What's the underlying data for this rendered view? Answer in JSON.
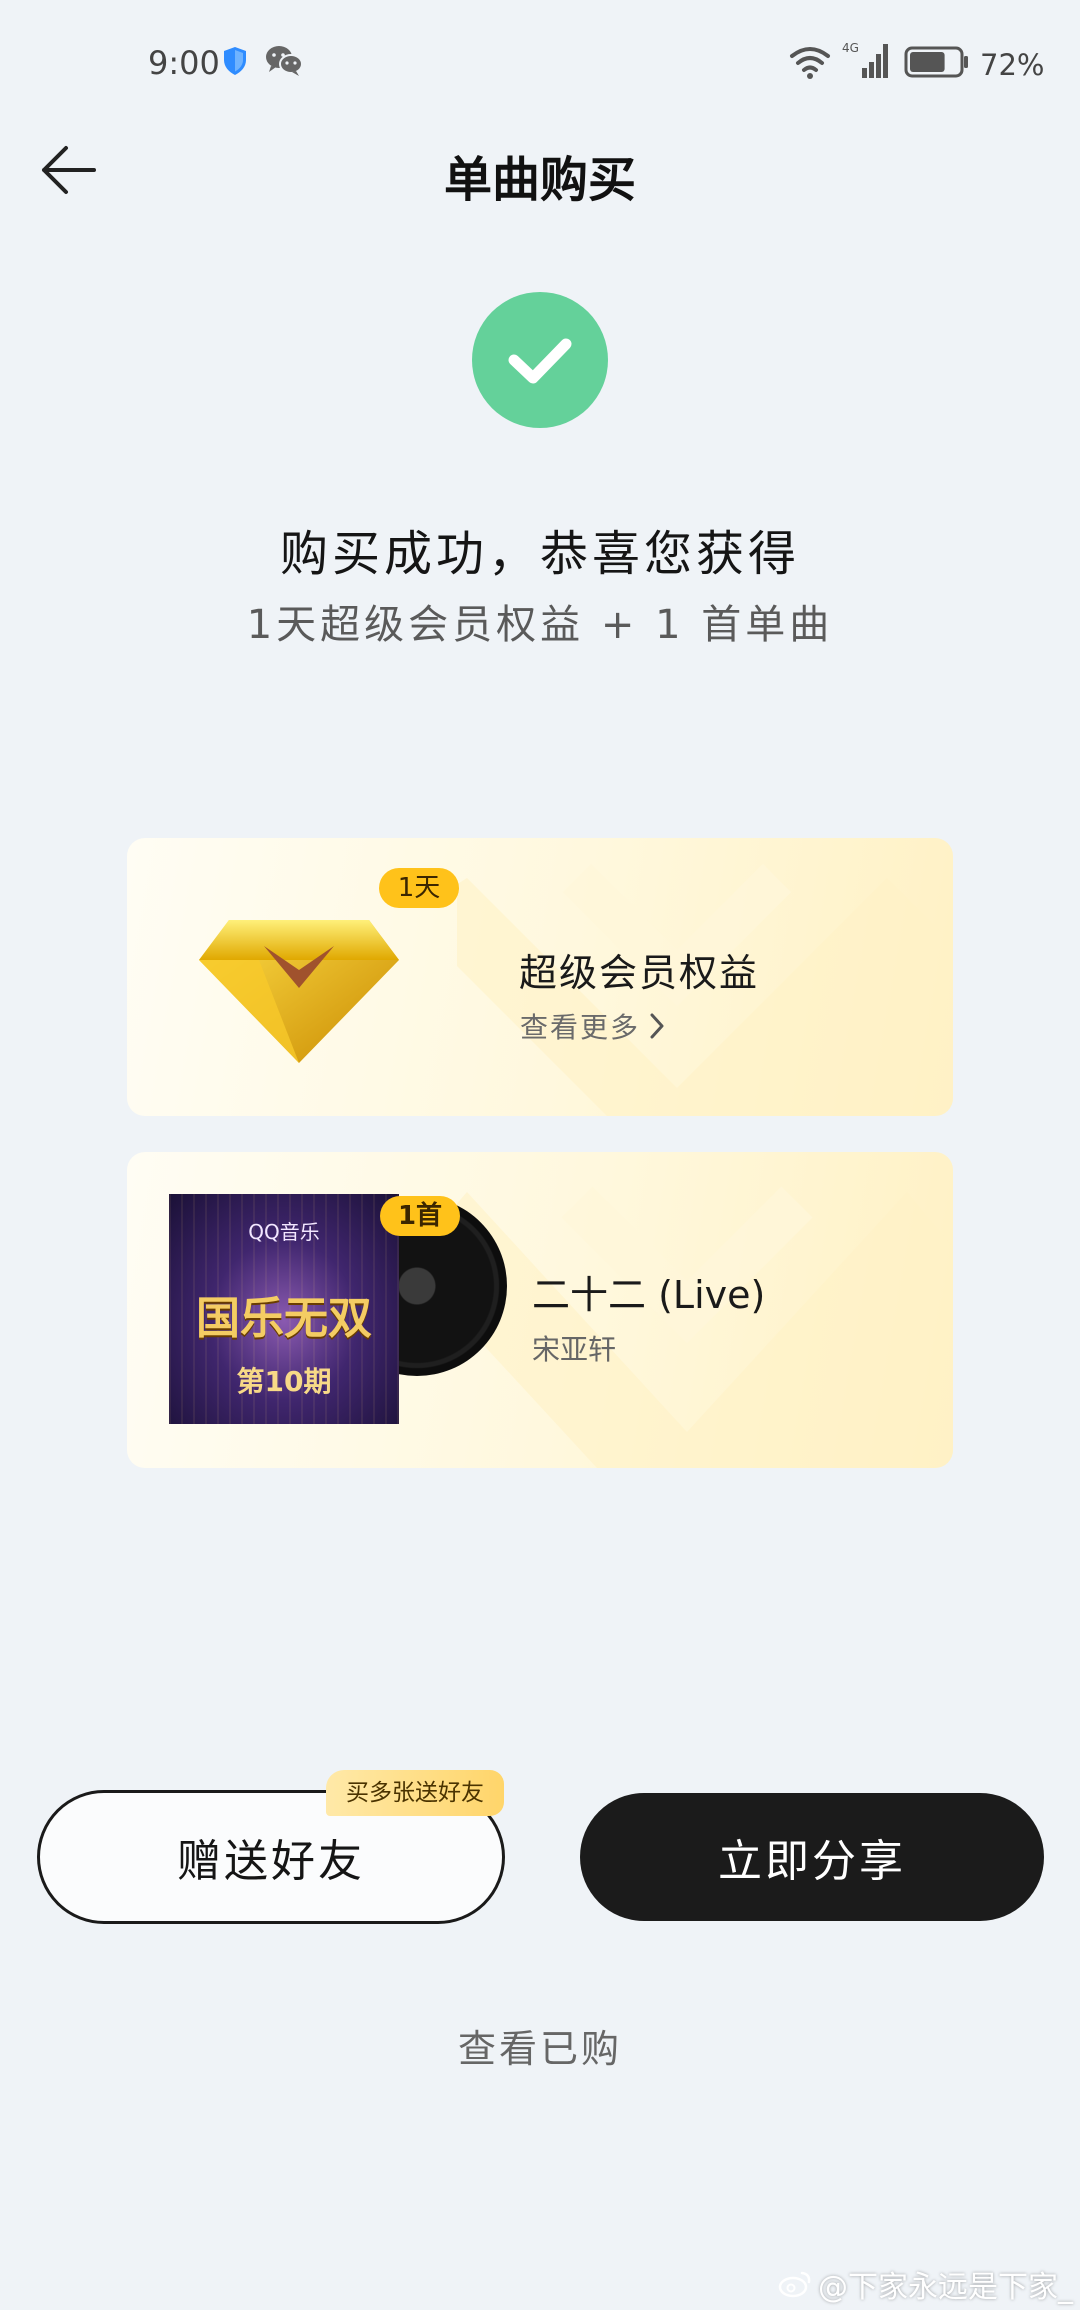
{
  "status_bar": {
    "time": "9:00",
    "network": "4G",
    "battery_percent": "72%",
    "battery_level": 0.72
  },
  "header": {
    "title": "单曲购买"
  },
  "success": {
    "title": "购买成功，恭喜您获得",
    "subtitle": "1天超级会员权益 + 1 首单曲"
  },
  "vip_card": {
    "badge": "1天",
    "name": "超级会员权益",
    "more_label": "查看更多"
  },
  "song_card": {
    "badge": "1首",
    "name": "二十二 (Live)",
    "artist": "宋亚轩",
    "cover": {
      "logo": "QQ音乐",
      "title": "国乐无双",
      "episode": "第10期"
    }
  },
  "actions": {
    "gift_label": "赠送好友",
    "gift_tag": "买多张送好友",
    "share_label": "立即分享",
    "view_bought_label": "查看已购"
  },
  "watermark": "@下家永远是下家_",
  "colors": {
    "success_green": "#64d19a",
    "badge_yellow": "#ffc21a",
    "primary_dark": "#1b1b1b",
    "page_background": "#eff3f7"
  }
}
